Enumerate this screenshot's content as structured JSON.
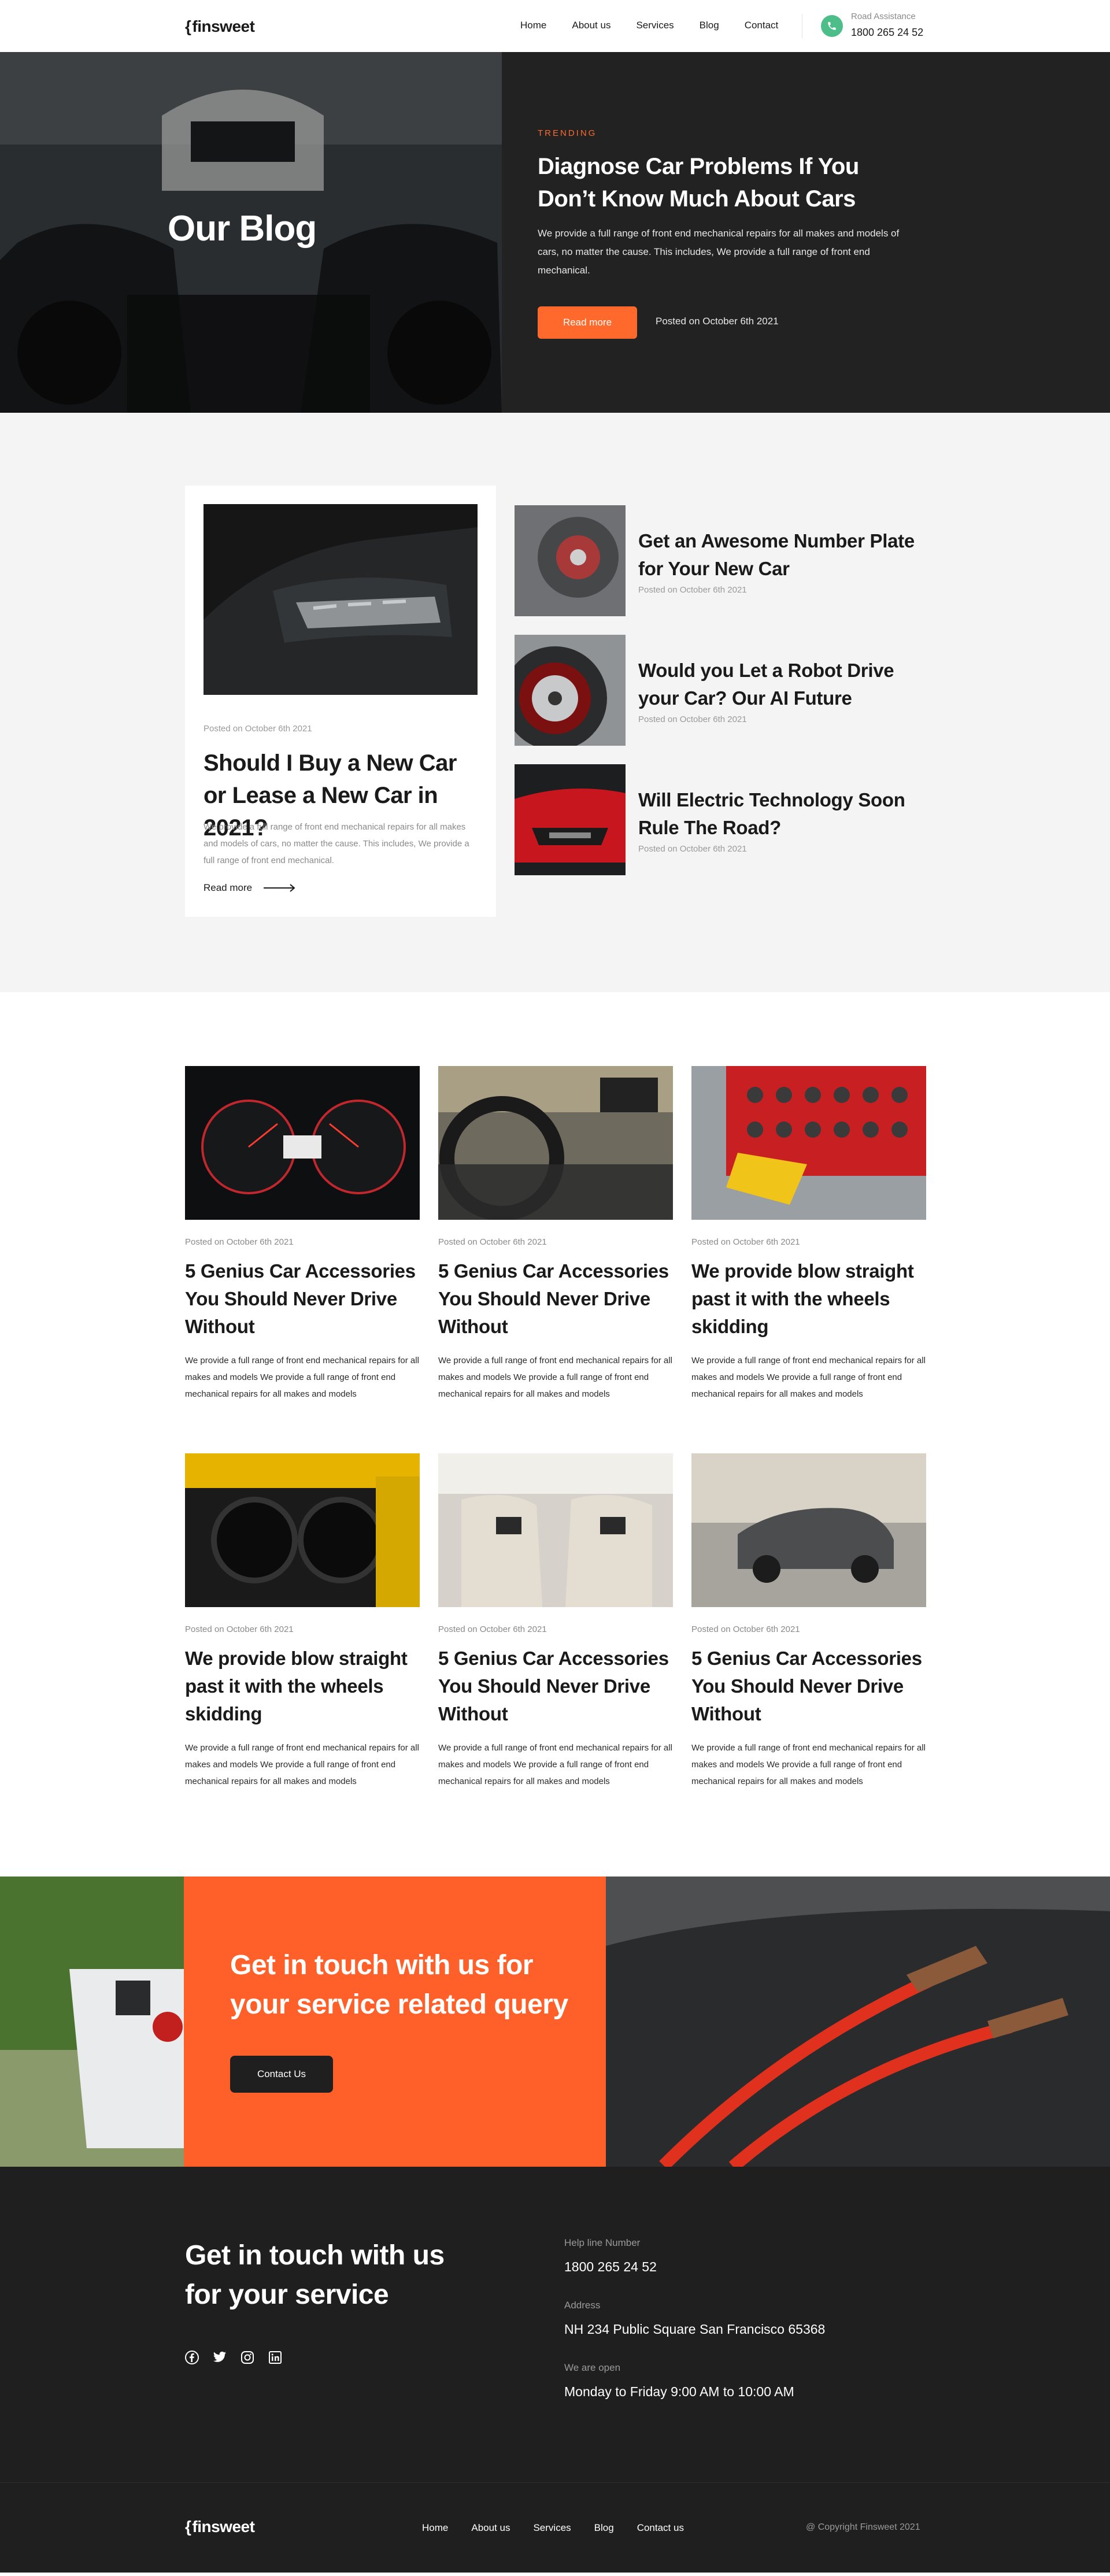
{
  "nav": {
    "logo": "finsweet",
    "links": [
      "Home",
      "About us",
      "Services",
      "Blog",
      "Contact"
    ],
    "road_label": "Road Assistance",
    "road_phone": "1800 265 24 52"
  },
  "hero": {
    "page_title": "Our Blog",
    "tag": "TRENDING",
    "title": "Diagnose Car Problems If You Don’t Know Much About Cars",
    "text": "We provide a full range of front end mechanical repairs for all makes and models of cars, no matter the cause. This includes, We provide a full range of front end mechanical.",
    "button": "Read more",
    "date": "Posted on October 6th 2021"
  },
  "featured": {
    "date": "Posted on October 6th 2021",
    "title": "Should I Buy a New Car or Lease a New Car in 2021?",
    "text": "We provide a full range of front end mechanical repairs for all makes and models of cars, no matter the cause. This includes, We provide a full range of front end mechanical.",
    "read_more": "Read more",
    "side": [
      {
        "title": "Get an Awesome Number Plate for Your New Car",
        "date": "Posted on October 6th 2021"
      },
      {
        "title": "Would you Let a Robot Drive your Car? Our AI Future",
        "date": "Posted on October 6th 2021"
      },
      {
        "title": "Will Electric Technology Soon Rule The Road?",
        "date": "Posted on October 6th 2021"
      }
    ]
  },
  "grid": [
    {
      "date": "Posted on October 6th 2021",
      "title": "5 Genius Car Accessories You Should Never Drive Without",
      "text": "We provide a full range of front end mechanical repairs for all makes and models We provide a full range of front end mechanical repairs for all makes and models"
    },
    {
      "date": "Posted on October 6th 2021",
      "title": "5 Genius Car Accessories You Should Never Drive Without",
      "text": "We provide a full range of front end mechanical repairs for all makes and models We provide a full range of front end mechanical repairs for all makes and models"
    },
    {
      "date": "Posted on October 6th 2021",
      "title": "We provide blow straight past it with the wheels skidding",
      "text": "We provide a full range of front end mechanical repairs for all makes and models We provide a full range of front end mechanical repairs for all makes and models"
    },
    {
      "date": "Posted on October 6th 2021",
      "title": "We provide blow straight past it with the wheels skidding",
      "text": "We provide a full range of front end mechanical repairs for all makes and models We provide a full range of front end mechanical repairs for all makes and models"
    },
    {
      "date": "Posted on October 6th 2021",
      "title": "5 Genius Car Accessories You Should Never Drive Without",
      "text": "We provide a full range of front end mechanical repairs for all makes and models We provide a full range of front end mechanical repairs for all makes and models"
    },
    {
      "date": "Posted on October 6th 2021",
      "title": "5 Genius Car Accessories You Should Never Drive Without",
      "text": "We provide a full range of front end mechanical repairs for all makes and models We provide a full range of front end mechanical repairs for all makes and models"
    }
  ],
  "cta": {
    "title": "Get in touch with us for your service related query",
    "button": "Contact Us"
  },
  "contact": {
    "title": "Get in touch with us for your  service",
    "help_label": "Help line Number",
    "help_value": "1800 265 24 52",
    "address_label": "Address",
    "address_value": "NH 234  Public Square San Francisco  65368",
    "open_label": "We are open",
    "open_value": "Monday to Friday 9:00 AM to  10:00  AM"
  },
  "footer": {
    "logo": "finsweet",
    "links": [
      "Home",
      "About us",
      "Services",
      "Blog",
      "Contact us"
    ],
    "copyright": "@ Copyright Finsweet 2021"
  },
  "colors": {
    "accent": "#ff6a2c",
    "dark": "#1f1f1f",
    "green": "#4dbd8a"
  }
}
